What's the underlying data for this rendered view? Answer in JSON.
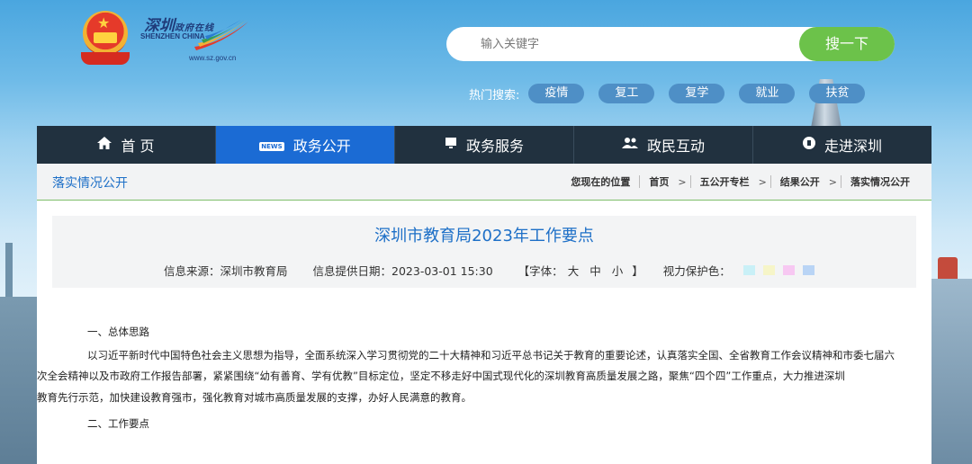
{
  "header": {
    "logo_cn": "深圳",
    "logo_cn_small": "政府在线",
    "logo_en": "SHENZHEN CHINA",
    "logo_url": "www.sz.gov.cn",
    "search_placeholder": "输入关键字",
    "search_button": "搜一下",
    "hot_label": "热门搜索:",
    "hot_tags": [
      "疫情",
      "复工",
      "复学",
      "就业",
      "扶贫"
    ]
  },
  "nav": {
    "items": [
      {
        "label": "首 页",
        "icon": "home-icon"
      },
      {
        "label": "政务公开",
        "icon": "news-icon",
        "icon_text": "NEWS"
      },
      {
        "label": "政务服务",
        "icon": "monitor-icon"
      },
      {
        "label": "政民互动",
        "icon": "people-icon"
      },
      {
        "label": "走进深圳",
        "icon": "city-icon"
      }
    ],
    "active_index": 1
  },
  "section": {
    "title": "落实情况公开",
    "breadcrumb_label": "您现在的位置",
    "breadcrumb": [
      "首页",
      "五公开专栏",
      "结果公开",
      "落实情况公开"
    ]
  },
  "article": {
    "title": "深圳市教育局2023年工作要点",
    "source": "信息来源：深圳市教育局",
    "date": "信息提供日期：2023-03-01 15:30",
    "font_open": "【字体：",
    "font_sizes": [
      "大",
      "中",
      "小"
    ],
    "font_close": "】",
    "eye_label": "视力保护色：",
    "eye_colors": [
      "#c9f0f7",
      "#f6f5c8",
      "#f7c8f2",
      "#b9d4f5"
    ],
    "heading1": "一、总体思路",
    "paragraph1_line1": "以习近平新时代中国特色社会主义思想为指导，全面系统深入学习贯彻党的二十大精神和习近平总书记关于教育的重要论述，认真落实全国、全省教育工作会议精神和市委七届六",
    "paragraph1_line2": "次全会精神以及市政府工作报告部署，紧紧围绕“幼有善育、学有优教”目标定位，坚定不移走好中国式现代化的深圳教育高质量发展之路，聚焦“四个四”工作重点，大力推进深圳",
    "paragraph1_line3": "教育先行示范，加快建设教育强市，强化教育对城市高质量发展的支撑，办好人民满意的教育。",
    "heading2": "二、工作要点"
  },
  "colors": {
    "nav_bg": "#21313f",
    "nav_active": "#1b6bd4",
    "accent_blue": "#1d6fc7",
    "search_green": "#6cc24a"
  }
}
